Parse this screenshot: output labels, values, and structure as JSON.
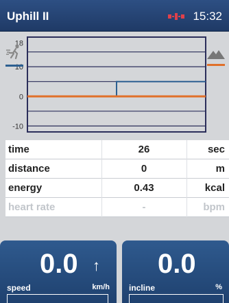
{
  "header": {
    "title": "Uphill II",
    "time": "15:32"
  },
  "chart_data": {
    "type": "line",
    "yticks": [
      "18",
      "10",
      "0",
      "-10"
    ],
    "ylim": [
      -12,
      20
    ],
    "grid": true,
    "series": [
      {
        "values": [
          [
            0,
            0
          ],
          [
            10,
            0
          ],
          [
            10,
            5
          ],
          [
            20,
            5
          ]
        ],
        "color": "#2c5f91"
      },
      {
        "values": [
          [
            0,
            0
          ],
          [
            20,
            0
          ]
        ],
        "color": "#e0702a"
      }
    ]
  },
  "stats": [
    {
      "key": "time",
      "value": "26",
      "unit": "sec"
    },
    {
      "key": "distance",
      "value": "0",
      "unit": "m"
    },
    {
      "key": "energy",
      "value": "0.43",
      "unit": "kcal"
    },
    {
      "key": "heart rate",
      "value": "-",
      "unit": "bpm"
    }
  ],
  "speed": {
    "value": "0.0",
    "label": "speed",
    "unit": "km/h"
  },
  "incline": {
    "value": "0.0",
    "label": "incline",
    "unit": "%"
  }
}
